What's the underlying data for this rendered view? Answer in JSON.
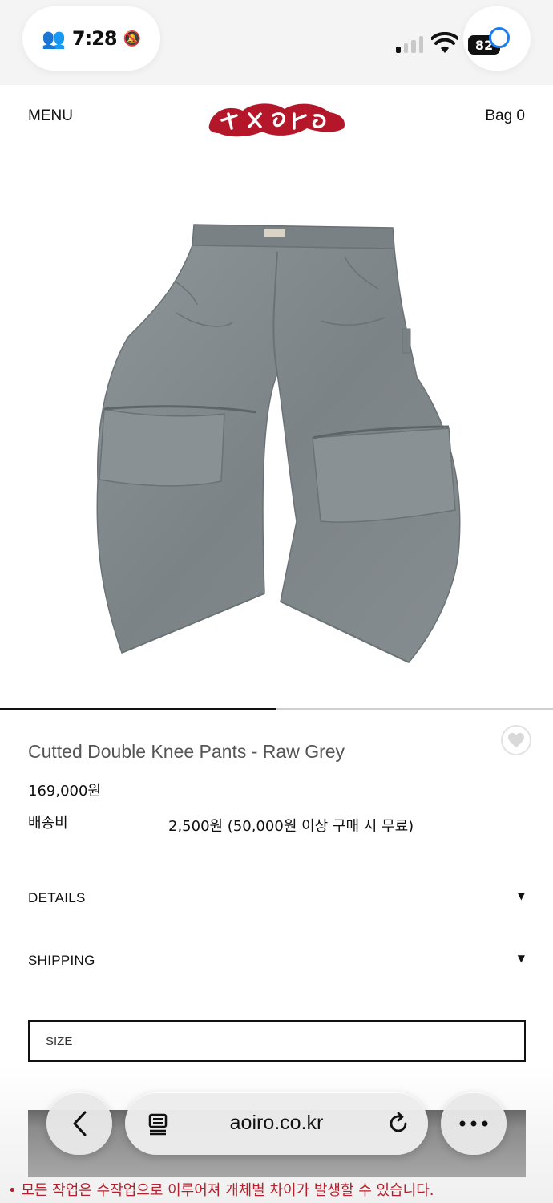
{
  "status_bar": {
    "time": "7:28",
    "battery": "82"
  },
  "header": {
    "menu_label": "MENU",
    "bag_label": "Bag 0",
    "logo_text": "aoiro",
    "logo_color": "#b4172a"
  },
  "carousel": {
    "progress": 0.5
  },
  "product": {
    "title": "Cutted Double Knee Pants - Raw Grey",
    "price": "169,000원",
    "shipping_label": "배송비",
    "shipping_value": "2,500원 (50,000원 이상 구매 시 무료)",
    "image_icon": "grey-pants-photo"
  },
  "accordions": {
    "details": "DETAILS",
    "shipping": "SHIPPING",
    "arrow": "▼"
  },
  "size_select": {
    "label": "SIZE"
  },
  "browser": {
    "url": "aoiro.co.kr",
    "back_icon": "chevron-left-icon",
    "reader_icon": "reader-icon",
    "reload_icon": "reload-icon",
    "more_icon": "more-dots-icon"
  },
  "notice": "• 모든 작업은 수작업으로 이루어져 개체별 차이가 발생할 수 있습니다."
}
